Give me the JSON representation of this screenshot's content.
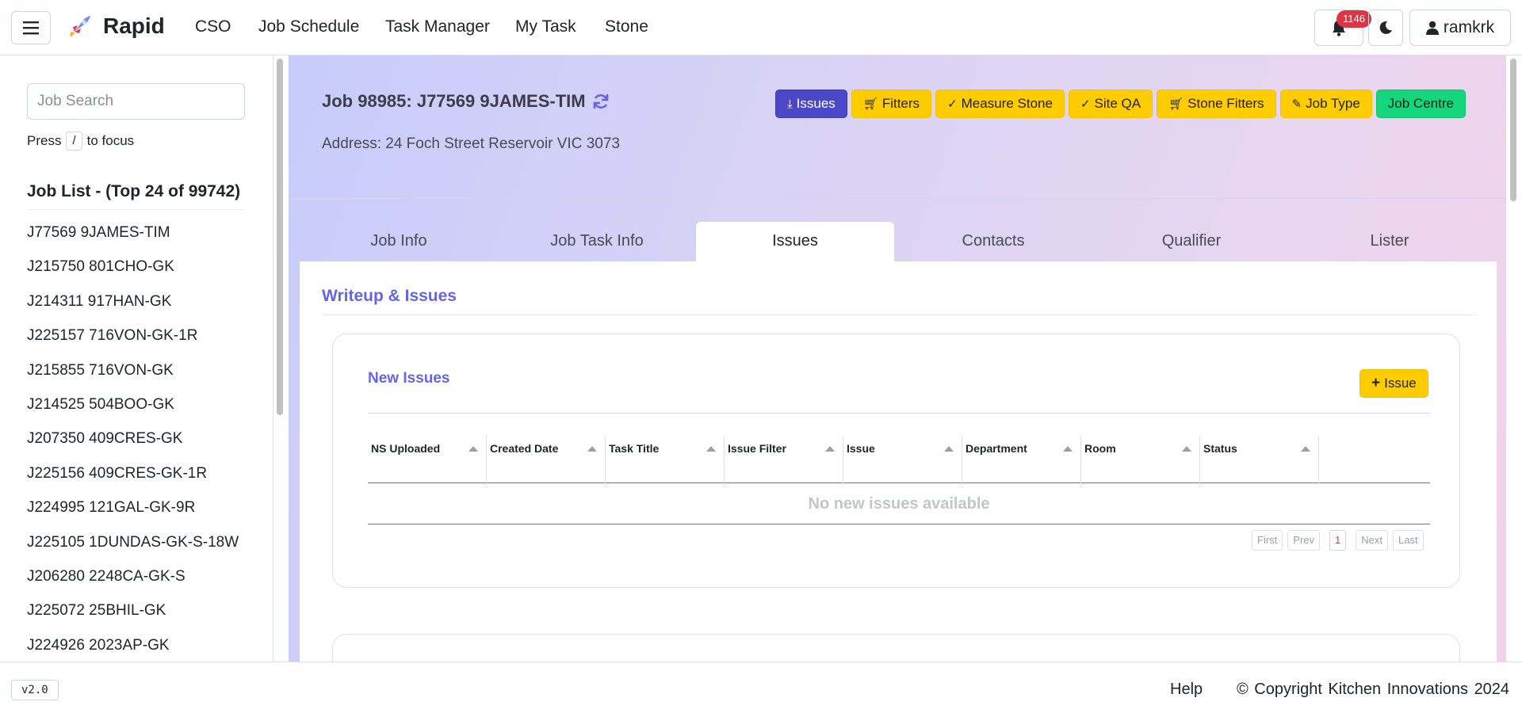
{
  "app": {
    "name": "Rapid"
  },
  "nav": {
    "items": [
      "CSO",
      "Job Schedule",
      "Task Manager",
      "My Task",
      "Stone"
    ]
  },
  "header_right": {
    "notification_count": "1146",
    "username": "ramkrk"
  },
  "sidebar": {
    "search_placeholder": "Job Search",
    "hint_prefix": "Press",
    "hint_key": "/",
    "hint_suffix": "to focus",
    "list_title": "Job List - (Top 24 of 99742)",
    "jobs": [
      "J77569 9JAMES-TIM",
      "J215750 801CHO-GK",
      "J214311 917HAN-GK",
      "J225157 716VON-GK-1R",
      "J215855 716VON-GK",
      "J214525 504BOO-GK",
      "J207350 409CRES-GK",
      "J225156 409CRES-GK-1R",
      "J224995 121GAL-GK-9R",
      "J225105 1DUNDAS-GK-S-18W",
      "J206280 2248CA-GK-S",
      "J225072 25BHIL-GK",
      "J224926 2023AP-GK"
    ]
  },
  "job": {
    "title": "Job 98985: J77569 9JAMES-TIM",
    "address": "Address: 24 Foch Street Reservoir VIC 3073"
  },
  "actions": {
    "issues": "Issues",
    "fitters": "Fitters",
    "measure_stone": "Measure Stone",
    "site_qa": "Site QA",
    "stone_fitters": "Stone Fitters",
    "job_type": "Job Type",
    "job_centre": "Job Centre"
  },
  "tabs": [
    "Job Info",
    "Job Task Info",
    "Issues",
    "Contacts",
    "Qualifier",
    "Lister"
  ],
  "issues_panel": {
    "section_title": "Writeup & Issues",
    "card_title": "New Issues",
    "add_button": "Issue",
    "columns": [
      "NS Uploaded",
      "Created Date",
      "Task Title",
      "Issue Filter",
      "Issue",
      "Department",
      "Room",
      "Status"
    ],
    "empty_message": "No new issues available",
    "pager": {
      "first": "First",
      "prev": "Prev",
      "current": "1",
      "next": "Next",
      "last": "Last"
    }
  },
  "footer": {
    "version": "v2.0",
    "help": "Help",
    "copyright": "© Copyright  Kitchen Innovations  2024"
  },
  "colors": {
    "primary": "#4b47c9",
    "warning": "#ffcc00",
    "success": "#15d67c",
    "accent_text": "#6565e8",
    "badge": "#dc3545"
  }
}
